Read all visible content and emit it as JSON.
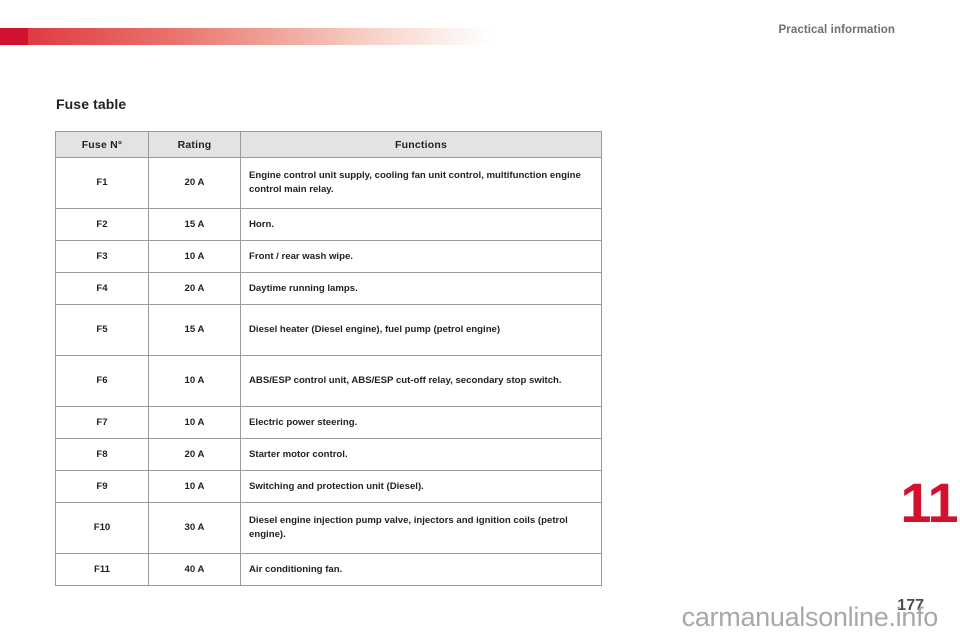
{
  "header": {
    "section_label": "Practical information",
    "bar_accent_color": "#d2112f"
  },
  "page_title": "Fuse table",
  "table": {
    "columns": [
      "Fuse N°",
      "Rating",
      "Functions"
    ],
    "rows": [
      {
        "fuse": "F1",
        "rating": "20 A",
        "functions": "Engine control unit supply, cooling fan unit control, multifunction engine control main relay.",
        "lines": 2
      },
      {
        "fuse": "F2",
        "rating": "15 A",
        "functions": "Horn.",
        "lines": 1
      },
      {
        "fuse": "F3",
        "rating": "10 A",
        "functions": "Front / rear wash wipe.",
        "lines": 1
      },
      {
        "fuse": "F4",
        "rating": "20 A",
        "functions": "Daytime running lamps.",
        "lines": 1
      },
      {
        "fuse": "F5",
        "rating": "15 A",
        "functions": "Diesel heater (Diesel engine), fuel pump (petrol engine)",
        "lines": 2
      },
      {
        "fuse": "F6",
        "rating": "10 A",
        "functions": "ABS/ESP control unit, ABS/ESP cut-off relay, secondary stop switch.",
        "lines": 2
      },
      {
        "fuse": "F7",
        "rating": "10 A",
        "functions": "Electric power steering.",
        "lines": 1
      },
      {
        "fuse": "F8",
        "rating": "20 A",
        "functions": "Starter motor control.",
        "lines": 1
      },
      {
        "fuse": "F9",
        "rating": "10 A",
        "functions": "Switching and protection unit (Diesel).",
        "lines": 1
      },
      {
        "fuse": "F10",
        "rating": "30 A",
        "functions": "Diesel engine injection pump valve, injectors and ignition coils (petrol engine).",
        "lines": 2
      },
      {
        "fuse": "F11",
        "rating": "40 A",
        "functions": "Air conditioning fan.",
        "lines": 1
      }
    ]
  },
  "chapter_tab": {
    "number": "11",
    "color": "#d2112f"
  },
  "footer": {
    "page_number": "177",
    "watermark": "carmanualsonline.info"
  }
}
